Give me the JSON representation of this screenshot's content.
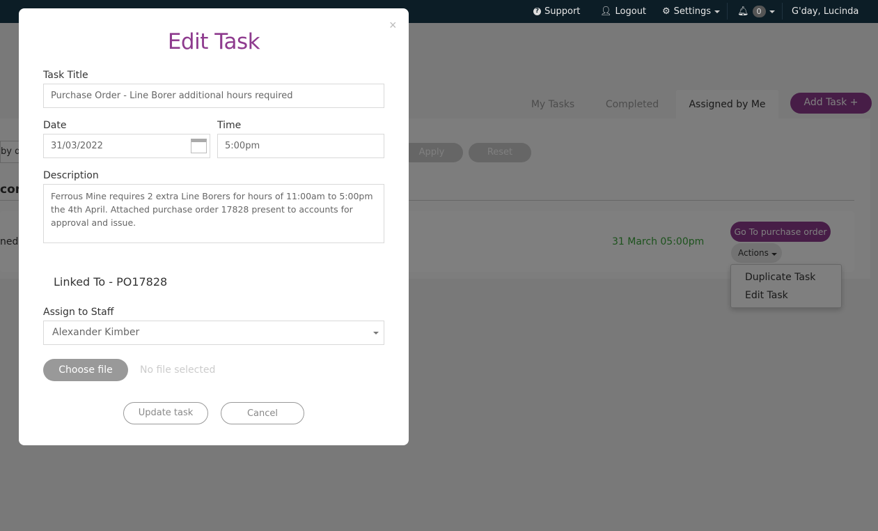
{
  "topbar": {
    "support": "Support",
    "logout": "Logout",
    "settings": "Settings",
    "notifications_count": "0",
    "greeting": "G'day, Lucinda"
  },
  "tabs": [
    {
      "label": "My Tasks"
    },
    {
      "label": "Completed"
    },
    {
      "label": "Assigned by Me",
      "active": true
    }
  ],
  "add_task": "Add Task +",
  "filter": {
    "partial_input": "by d",
    "apply": "Apply",
    "reset": "Reset"
  },
  "section_partial": "com",
  "task_row": {
    "partial_text": "ned",
    "due": "31 March 05:00pm",
    "goto": "Go To purchase order",
    "actions": "Actions"
  },
  "actions_menu": [
    "Duplicate Task",
    "Edit Task"
  ],
  "modal": {
    "title": "Edit Task",
    "close": "×",
    "task_title_label": "Task Title",
    "task_title_value": "Purchase Order  - Line Borer additional hours required",
    "date_label": "Date",
    "date_value": "31/03/2022",
    "time_label": "Time",
    "time_value": "5:00pm",
    "description_label": "Description",
    "description_value": "Ferrous Mine requires 2 extra Line Borers for hours of 11:00am to 5:00pm the 4th April. Attached purchase order 17828 present to accounts for approval and issue.",
    "linked_to": "Linked To - PO17828",
    "assign_label": "Assign to Staff",
    "assign_value": "Alexander Kimber",
    "choose_file": "Choose file",
    "no_file": "No file selected",
    "update": "Update task",
    "cancel": "Cancel"
  },
  "colors": {
    "brand": "#8e3b8e",
    "due_green": "#3aa53a",
    "topbar": "#0c1d26"
  }
}
